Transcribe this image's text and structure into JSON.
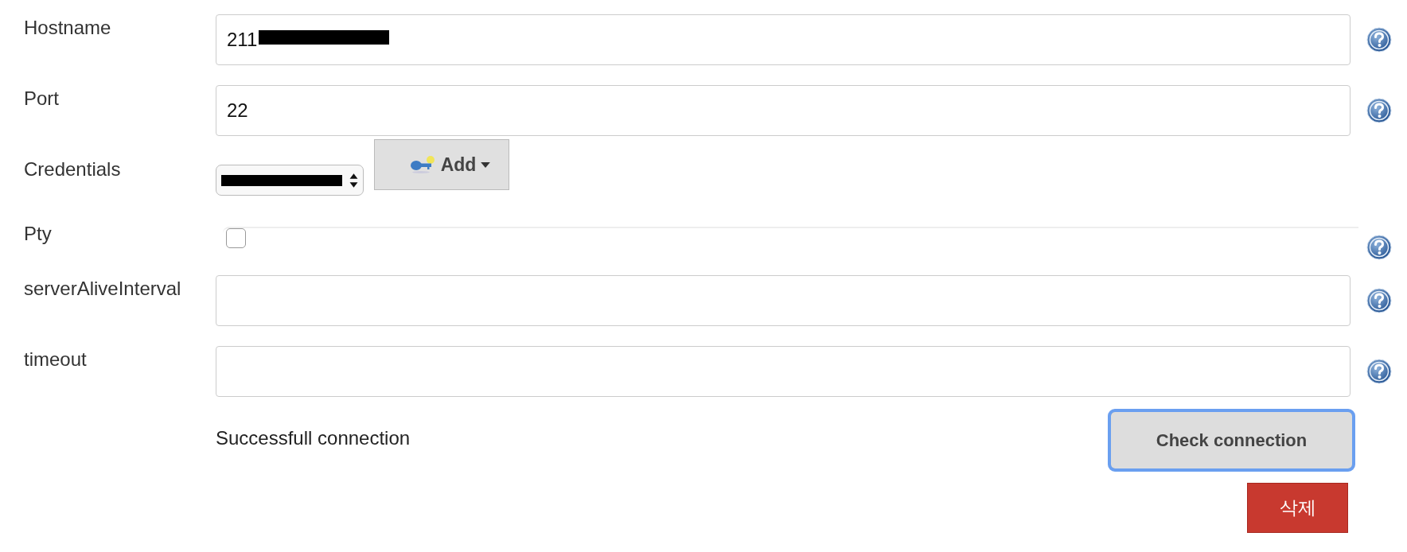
{
  "fields": [
    {
      "label": "Hostname",
      "kind": "text",
      "value": "211",
      "redacted": true,
      "help": true
    },
    {
      "label": "Port",
      "kind": "text",
      "value": "22",
      "redacted": false,
      "help": true
    },
    {
      "label": "Credentials",
      "kind": "select",
      "redacted": true,
      "add_button": "Add",
      "help": false
    },
    {
      "label": "Pty",
      "kind": "checkbox",
      "checked": false,
      "help": true
    },
    {
      "label": "serverAliveInterval",
      "kind": "text",
      "redacted": false,
      "help": true
    },
    {
      "label": "timeout",
      "kind": "text",
      "redacted": false,
      "help": true
    }
  ],
  "status_message": "Successfull connection",
  "check_button": {
    "label": "Check connection",
    "focused": true
  },
  "delete_button": "삭제"
}
